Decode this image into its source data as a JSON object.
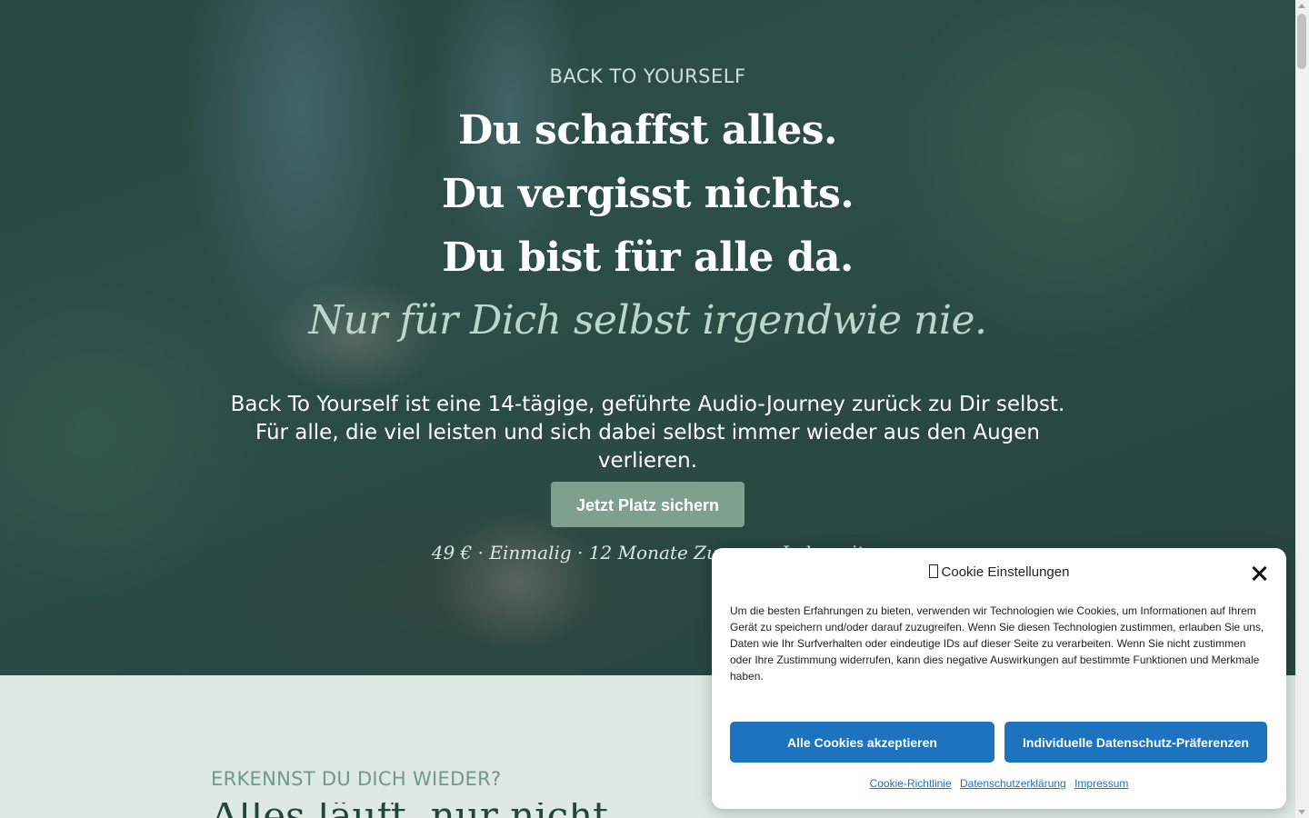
{
  "hero": {
    "eyebrow": "BACK TO YOURSELF",
    "headline_lines": [
      "Du schaffst alles.",
      "Du vergisst nichts.",
      "Du bist für alle da."
    ],
    "tagline": "Nur für Dich selbst irgendwie nie.",
    "intro": "Back To Yourself ist eine 14-tägige, geführte Audio-Journey zurück zu Dir selbst. Für alle, die viel leisten und sich dabei selbst immer wieder aus den Augen verlieren.",
    "cta_label": "Jetzt Platz sichern",
    "price_note": "49 € · Einmalig · 12 Monate Zugang · Jederzeit"
  },
  "section2": {
    "eyebrow": "ERKENNST DU DICH WIEDER?",
    "heading_partial": "Alles läuft, nur nicht"
  },
  "cookie_banner": {
    "title": "Cookie Einstellungen",
    "body": "Um die besten Erfahrungen zu bieten, verwenden wir Technologien wie Cookies, um Informationen auf Ihrem Gerät zu speichern und/oder darauf zuzugreifen. Wenn Sie diesen Technologien zustimmen, erlauben Sie uns, Daten wie Ihr Surfverhalten oder eindeutige IDs auf dieser Seite zu verarbeiten. Wenn Sie nicht zustimmen oder Ihre Zustimmung widerrufen, kann dies negative Auswirkungen auf bestimmte Funktionen und Merkmale haben.",
    "accept_label": "Alle Cookies akzeptieren",
    "preferences_label": "Individuelle Datenschutz-Präferenzen",
    "links": [
      "Cookie-Richtlinie",
      "Datenschutzerklärung",
      "Impressum"
    ]
  },
  "colors": {
    "cta": "#7fa08f",
    "accent_blue": "#1e73be",
    "section_bg": "#dde9e2"
  }
}
